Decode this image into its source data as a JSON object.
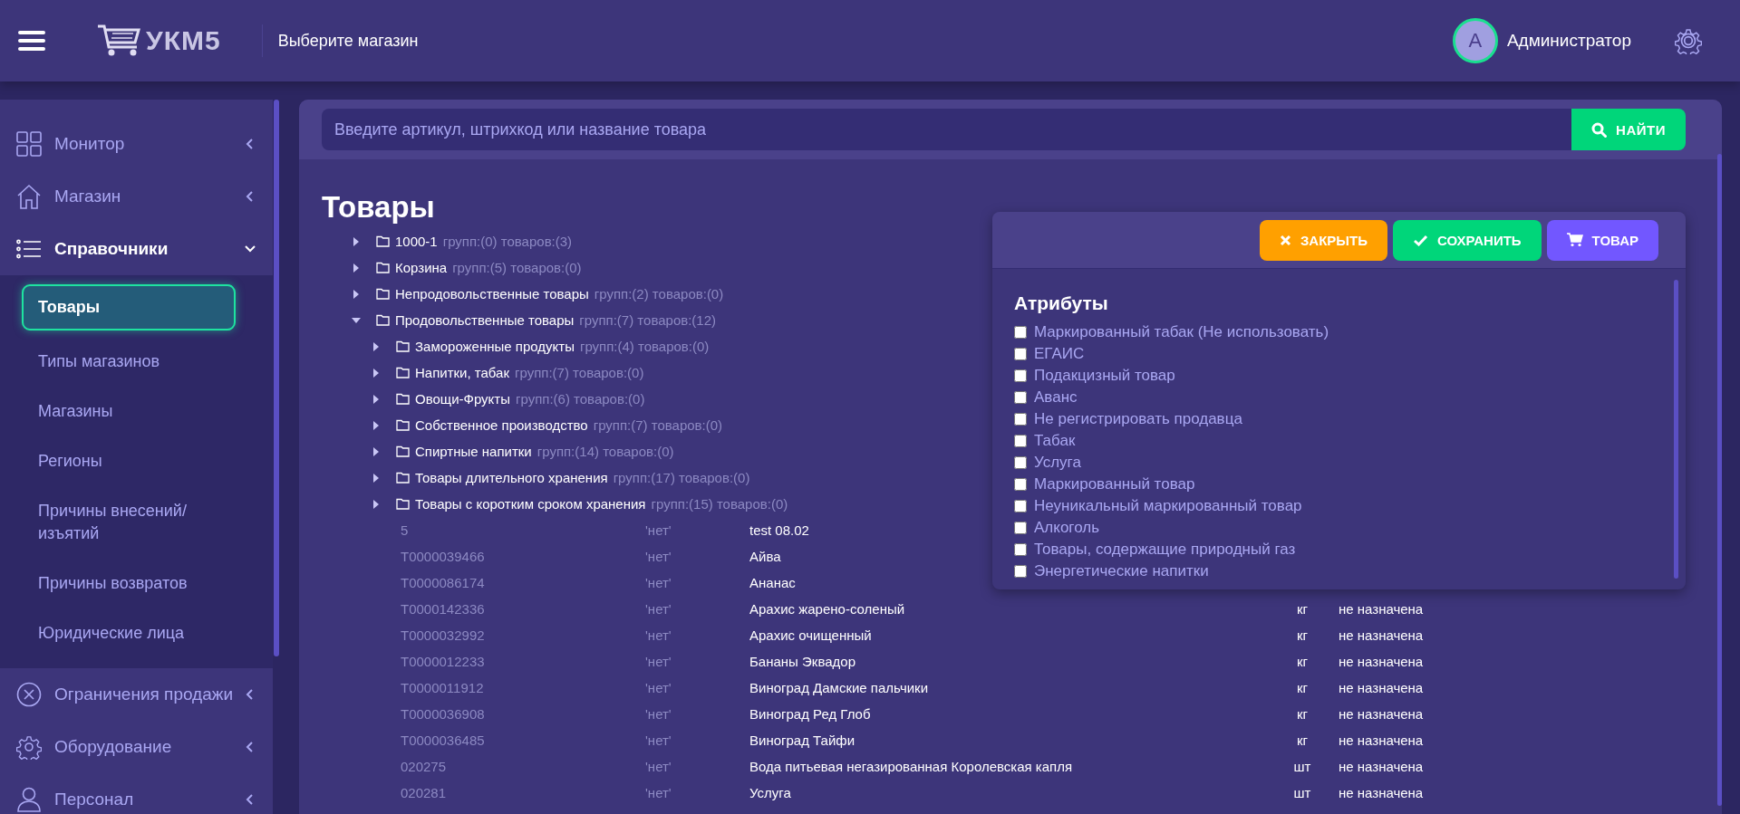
{
  "header": {
    "logo": "УКМ5",
    "store_picker": "Выберите магазин",
    "user": {
      "initial": "А",
      "name": "Администратор"
    }
  },
  "sidebar": {
    "items": [
      {
        "label": "Монитор",
        "expanded": false
      },
      {
        "label": "Магазин",
        "expanded": false
      },
      {
        "label": "Справочники",
        "expanded": true,
        "children": [
          {
            "label": "Товары",
            "selected": true
          },
          {
            "label": "Типы магазинов",
            "selected": false
          },
          {
            "label": "Магазины",
            "selected": false
          },
          {
            "label": "Регионы",
            "selected": false
          },
          {
            "label": "Причины внесений/ изъятий",
            "selected": false
          },
          {
            "label": "Причины возвратов",
            "selected": false
          },
          {
            "label": "Юридические лица",
            "selected": false
          }
        ]
      },
      {
        "label": "Ограничения продажи",
        "expanded": false
      },
      {
        "label": "Оборудование",
        "expanded": false
      },
      {
        "label": "Персонал",
        "expanded": false
      }
    ]
  },
  "search": {
    "placeholder": "Введите артикул, штрихкод или название товара",
    "button": "НАЙТИ"
  },
  "page_title": "Товары",
  "tree": [
    {
      "name": "1000-1",
      "info": "групп:(0) товаров:(3)",
      "expanded": false
    },
    {
      "name": "Корзина",
      "info": "групп:(5) товаров:(0)",
      "expanded": false
    },
    {
      "name": "Непродовольственные товары",
      "info": "групп:(2) товаров:(0)",
      "expanded": false
    },
    {
      "name": "Продовольственные товары",
      "info": "групп:(7) товаров:(12)",
      "expanded": true,
      "children": [
        {
          "name": "Замороженные продукты",
          "info": "групп:(4) товаров:(0)",
          "expanded": false
        },
        {
          "name": "Напитки, табак",
          "info": "групп:(7) товаров:(0)",
          "expanded": false
        },
        {
          "name": "Овощи-Фрукты",
          "info": "групп:(6) товаров:(0)",
          "expanded": false
        },
        {
          "name": "Собственное производство",
          "info": "групп:(7) товаров:(0)",
          "expanded": false
        },
        {
          "name": "Спиртные напитки",
          "info": "групп:(14) товаров:(0)",
          "expanded": false
        },
        {
          "name": "Товары длительного хранения",
          "info": "групп:(17) товаров:(0)",
          "expanded": false
        },
        {
          "name": "Товары с коротким сроком хранения",
          "info": "групп:(15) товаров:(0)",
          "expanded": false
        }
      ],
      "products": [
        {
          "code": "5",
          "flag": "'нет'",
          "name": "test 08.02"
        },
        {
          "code": "T0000039466",
          "flag": "'нет'",
          "name": "Айва"
        },
        {
          "code": "T0000086174",
          "flag": "'нет'",
          "name": "Ананас"
        },
        {
          "code": "T0000142336",
          "flag": "'нет'",
          "name": "Арахис жарено-соленый",
          "unit": "кг",
          "status": "не назначена"
        },
        {
          "code": "T0000032992",
          "flag": "'нет'",
          "name": "Арахис очищенный",
          "unit": "кг",
          "status": "не назначена"
        },
        {
          "code": "T0000012233",
          "flag": "'нет'",
          "name": "Бананы Эквадор",
          "unit": "кг",
          "status": "не назначена"
        },
        {
          "code": "T0000011912",
          "flag": "'нет'",
          "name": "Виноград Дамские пальчики",
          "unit": "кг",
          "status": "не назначена"
        },
        {
          "code": "T0000036908",
          "flag": "'нет'",
          "name": "Виноград Ред Глоб",
          "unit": "кг",
          "status": "не назначена"
        },
        {
          "code": "T0000036485",
          "flag": "'нет'",
          "name": "Виноград Тайфи",
          "unit": "кг",
          "status": "не назначена"
        },
        {
          "code": "020275",
          "flag": "'нет'",
          "name": "Вода питьевая негазированная Королевская капля",
          "unit": "шт",
          "status": "не назначена"
        },
        {
          "code": "020281",
          "flag": "'нет'",
          "name": "Услуга",
          "unit": "шт",
          "status": "не назначена"
        }
      ]
    }
  ],
  "attributes_panel": {
    "buttons": [
      {
        "kind": "close",
        "label": "ЗАКРЫТЬ"
      },
      {
        "kind": "save",
        "label": "СОХРАНИТЬ"
      },
      {
        "kind": "product",
        "label": "ТОВАР"
      }
    ],
    "title": "Атрибуты",
    "attributes": [
      {
        "label": "Маркированный табак (Не использовать)",
        "checked": false
      },
      {
        "label": "ЕГАИС",
        "checked": false
      },
      {
        "label": "Подакцизный товар",
        "checked": false
      },
      {
        "label": "Аванс",
        "checked": false
      },
      {
        "label": "Не регистрировать продавца",
        "checked": false
      },
      {
        "label": "Табак",
        "checked": false
      },
      {
        "label": "Услуга",
        "checked": false
      },
      {
        "label": "Маркированный товар",
        "checked": false
      },
      {
        "label": "Неуникальный маркированный товар",
        "checked": false
      },
      {
        "label": "Алкоголь",
        "checked": false
      },
      {
        "label": "Товары, содержащие природный газ",
        "checked": false
      },
      {
        "label": "Энергетические напитки",
        "checked": false
      }
    ]
  }
}
